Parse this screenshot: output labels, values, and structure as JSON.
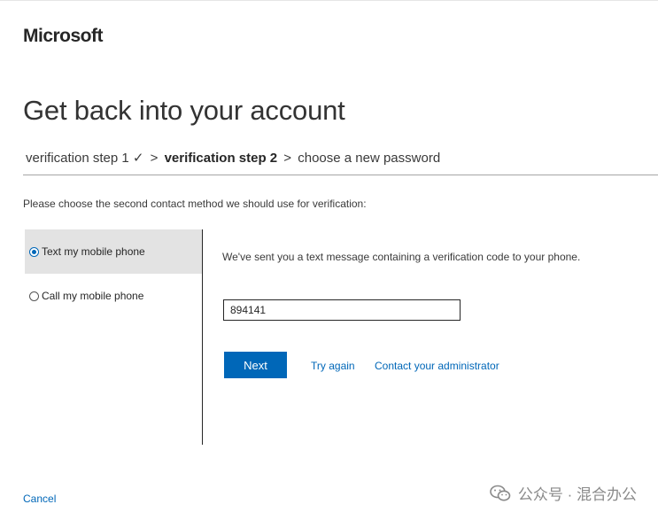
{
  "brand": {
    "name": "Microsoft"
  },
  "title": "Get back into your account",
  "steps": {
    "step1": "verification step 1 ✓",
    "separator": ">",
    "step2": "verification step 2",
    "step3": "choose a new password"
  },
  "instructions": "Please choose the second contact method we should use for verification:",
  "options": [
    {
      "label": "Text my mobile phone",
      "selected": true
    },
    {
      "label": "Call my mobile phone",
      "selected": false
    }
  ],
  "panel": {
    "message": "We've sent you a text message containing a verification code to your phone.",
    "code_value": "894141"
  },
  "actions": {
    "next_label": "Next",
    "try_again": "Try again",
    "contact_admin": "Contact your administrator",
    "cancel": "Cancel"
  },
  "watermark": {
    "text": "公众号 · 混合办公",
    "icon": "wechat-icon"
  },
  "colors": {
    "accent": "#0067b8",
    "selected_bg": "#e3e3e3"
  }
}
